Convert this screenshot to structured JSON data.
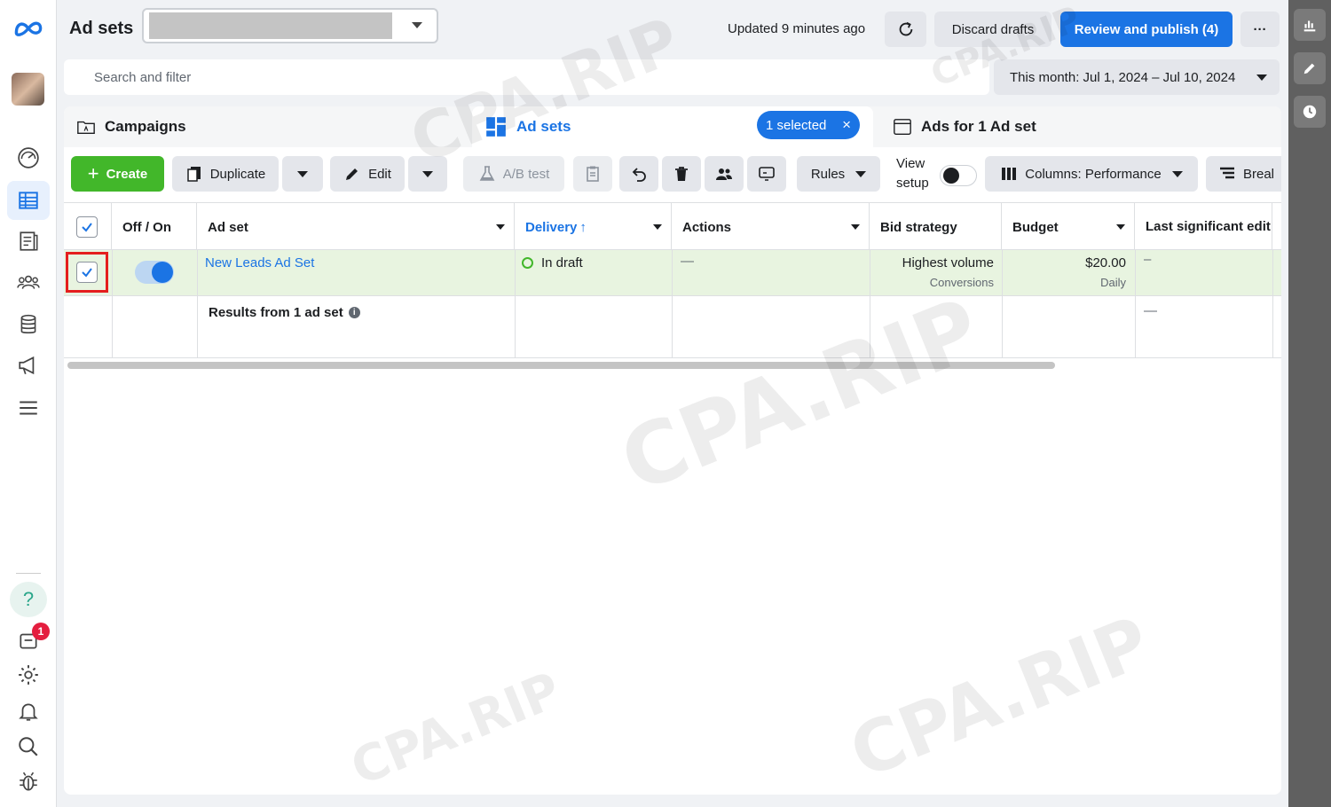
{
  "header": {
    "title": "Ad sets",
    "updated": "Updated 9 minutes ago",
    "discard_label": "Discard drafts",
    "publish_label": "Review and publish (4)",
    "more_label": "···"
  },
  "search": {
    "placeholder": "Search and filter",
    "date_range": "This month: Jul 1, 2024 – Jul 10, 2024"
  },
  "tabs": [
    {
      "label": "Campaigns"
    },
    {
      "label": "Ad sets",
      "selected_badge": "1 selected",
      "clear": "×"
    },
    {
      "label": "Ads for 1 Ad set"
    }
  ],
  "toolbar": {
    "create": "Create",
    "duplicate": "Duplicate",
    "edit": "Edit",
    "ab_test": "A/B test",
    "rules": "Rules",
    "view_setup_1": "View",
    "view_setup_2": "setup",
    "columns": "Columns: Performance",
    "breakdown": "Breal"
  },
  "table": {
    "headers": [
      "Off / On",
      "Ad set",
      "Delivery",
      "Actions",
      "Bid strategy",
      "Budget",
      "Last significant edit"
    ],
    "sort_arrow": "↑",
    "rows": [
      {
        "ad_set": "New Leads Ad Set",
        "delivery": "In draft",
        "actions": "—",
        "bid_strategy": "Highest volume",
        "bid_sub": "Conversions",
        "budget": "$20.00",
        "budget_sub": "Daily",
        "last_edit": "–"
      }
    ],
    "summary": {
      "label": "Results from 1 ad set",
      "last_edit": "—"
    }
  },
  "nav": {
    "notification_count": "1",
    "help": "?"
  },
  "watermark": "CPA.RIP",
  "colors": {
    "primary": "#1b74e4",
    "create": "#42b72a",
    "selected_row": "#e8f4e0",
    "highlight": "#e41e1e"
  }
}
